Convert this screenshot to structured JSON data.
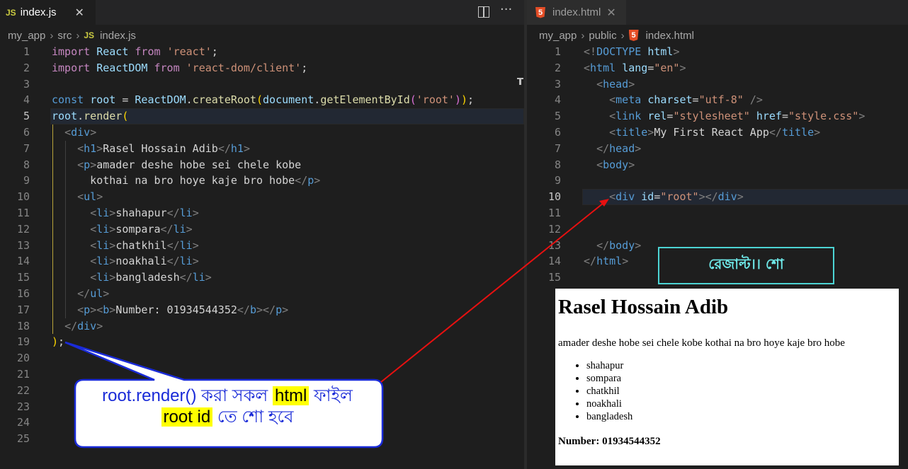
{
  "left_tab": {
    "icon": "JS",
    "label": "index.js",
    "close": "✕"
  },
  "left_breadcrumb": [
    "my_app",
    "src",
    "index.js"
  ],
  "left_active_line": 5,
  "left_lines": [
    [
      [
        "kw",
        "import"
      ],
      [
        "p",
        " "
      ],
      [
        "v",
        "React"
      ],
      [
        "p",
        " "
      ],
      [
        "kw",
        "from"
      ],
      [
        "p",
        " "
      ],
      [
        "s",
        "'react'"
      ],
      [
        "p",
        ";"
      ]
    ],
    [
      [
        "kw",
        "import"
      ],
      [
        "p",
        " "
      ],
      [
        "v",
        "ReactDOM"
      ],
      [
        "p",
        " "
      ],
      [
        "kw",
        "from"
      ],
      [
        "p",
        " "
      ],
      [
        "s",
        "'react-dom/client'"
      ],
      [
        "p",
        ";"
      ]
    ],
    [],
    [
      [
        "k",
        "const"
      ],
      [
        "p",
        " "
      ],
      [
        "v",
        "root"
      ],
      [
        "p",
        " = "
      ],
      [
        "v",
        "ReactDOM"
      ],
      [
        "p",
        "."
      ],
      [
        "f",
        "createRoot"
      ],
      [
        "y",
        "("
      ],
      [
        "v",
        "document"
      ],
      [
        "p",
        "."
      ],
      [
        "f",
        "getElementById"
      ],
      [
        "vio",
        "("
      ],
      [
        "s",
        "'root'"
      ],
      [
        "vio",
        ")"
      ],
      [
        "y",
        ")"
      ],
      [
        "p",
        ";"
      ]
    ],
    [
      [
        "v",
        "root"
      ],
      [
        "p",
        "."
      ],
      [
        "f",
        "render"
      ],
      [
        "y",
        "("
      ]
    ],
    [
      [
        "p",
        "  "
      ],
      [
        "g",
        "<"
      ],
      [
        "t",
        "div"
      ],
      [
        "g",
        ">"
      ]
    ],
    [
      [
        "p",
        "    "
      ],
      [
        "g",
        "<"
      ],
      [
        "t",
        "h1"
      ],
      [
        "g",
        ">"
      ],
      [
        "tx",
        "Rasel Hossain Adib"
      ],
      [
        "g",
        "</"
      ],
      [
        "t",
        "h1"
      ],
      [
        "g",
        ">"
      ]
    ],
    [
      [
        "p",
        "    "
      ],
      [
        "g",
        "<"
      ],
      [
        "t",
        "p"
      ],
      [
        "g",
        ">"
      ],
      [
        "tx",
        "amader deshe hobe sei chele kobe"
      ]
    ],
    [
      [
        "tx",
        "      kothai na bro hoye kaje bro hobe"
      ],
      [
        "g",
        "</"
      ],
      [
        "t",
        "p"
      ],
      [
        "g",
        ">"
      ]
    ],
    [
      [
        "p",
        "    "
      ],
      [
        "g",
        "<"
      ],
      [
        "t",
        "ul"
      ],
      [
        "g",
        ">"
      ]
    ],
    [
      [
        "p",
        "      "
      ],
      [
        "g",
        "<"
      ],
      [
        "t",
        "li"
      ],
      [
        "g",
        ">"
      ],
      [
        "tx",
        "shahapur"
      ],
      [
        "g",
        "</"
      ],
      [
        "t",
        "li"
      ],
      [
        "g",
        ">"
      ]
    ],
    [
      [
        "p",
        "      "
      ],
      [
        "g",
        "<"
      ],
      [
        "t",
        "li"
      ],
      [
        "g",
        ">"
      ],
      [
        "tx",
        "sompara"
      ],
      [
        "g",
        "</"
      ],
      [
        "t",
        "li"
      ],
      [
        "g",
        ">"
      ]
    ],
    [
      [
        "p",
        "      "
      ],
      [
        "g",
        "<"
      ],
      [
        "t",
        "li"
      ],
      [
        "g",
        ">"
      ],
      [
        "tx",
        "chatkhil"
      ],
      [
        "g",
        "</"
      ],
      [
        "t",
        "li"
      ],
      [
        "g",
        ">"
      ]
    ],
    [
      [
        "p",
        "      "
      ],
      [
        "g",
        "<"
      ],
      [
        "t",
        "li"
      ],
      [
        "g",
        ">"
      ],
      [
        "tx",
        "noakhali"
      ],
      [
        "g",
        "</"
      ],
      [
        "t",
        "li"
      ],
      [
        "g",
        ">"
      ]
    ],
    [
      [
        "p",
        "      "
      ],
      [
        "g",
        "<"
      ],
      [
        "t",
        "li"
      ],
      [
        "g",
        ">"
      ],
      [
        "tx",
        "bangladesh"
      ],
      [
        "g",
        "</"
      ],
      [
        "t",
        "li"
      ],
      [
        "g",
        ">"
      ]
    ],
    [
      [
        "p",
        "    "
      ],
      [
        "g",
        "</"
      ],
      [
        "t",
        "ul"
      ],
      [
        "g",
        ">"
      ]
    ],
    [
      [
        "p",
        "    "
      ],
      [
        "g",
        "<"
      ],
      [
        "t",
        "p"
      ],
      [
        "g",
        "><"
      ],
      [
        "t",
        "b"
      ],
      [
        "g",
        ">"
      ],
      [
        "tx",
        "Number: 01934544352"
      ],
      [
        "g",
        "</"
      ],
      [
        "t",
        "b"
      ],
      [
        "g",
        "></"
      ],
      [
        "t",
        "p"
      ],
      [
        "g",
        ">"
      ]
    ],
    [
      [
        "p",
        "  "
      ],
      [
        "g",
        "</"
      ],
      [
        "t",
        "div"
      ],
      [
        "g",
        ">"
      ]
    ],
    [
      [
        "y",
        ")"
      ],
      [
        "p",
        ";"
      ]
    ],
    [],
    [],
    [],
    [],
    [],
    []
  ],
  "right_tab": {
    "icon": "5",
    "label": "index.html",
    "close": "✕"
  },
  "right_breadcrumb": [
    "my_app",
    "public",
    "index.html"
  ],
  "right_active_line": 10,
  "right_lines": [
    [
      [
        "g",
        "<!"
      ],
      [
        "t",
        "DOCTYPE"
      ],
      [
        "p",
        " "
      ],
      [
        "a",
        "html"
      ],
      [
        "g",
        ">"
      ]
    ],
    [
      [
        "g",
        "<"
      ],
      [
        "t",
        "html"
      ],
      [
        "p",
        " "
      ],
      [
        "a",
        "lang"
      ],
      [
        "p",
        "="
      ],
      [
        "s",
        "\"en\""
      ],
      [
        "g",
        ">"
      ]
    ],
    [
      [
        "p",
        "  "
      ],
      [
        "g",
        "<"
      ],
      [
        "t",
        "head"
      ],
      [
        "g",
        ">"
      ]
    ],
    [
      [
        "p",
        "    "
      ],
      [
        "g",
        "<"
      ],
      [
        "t",
        "meta"
      ],
      [
        "p",
        " "
      ],
      [
        "a",
        "charset"
      ],
      [
        "p",
        "="
      ],
      [
        "s",
        "\"utf-8\""
      ],
      [
        "p",
        " "
      ],
      [
        "g",
        "/>"
      ]
    ],
    [
      [
        "p",
        "    "
      ],
      [
        "g",
        "<"
      ],
      [
        "t",
        "link"
      ],
      [
        "p",
        " "
      ],
      [
        "a",
        "rel"
      ],
      [
        "p",
        "="
      ],
      [
        "s",
        "\"stylesheet\""
      ],
      [
        "p",
        " "
      ],
      [
        "a",
        "href"
      ],
      [
        "p",
        "="
      ],
      [
        "s",
        "\"style.css\""
      ],
      [
        "g",
        ">"
      ]
    ],
    [
      [
        "p",
        "    "
      ],
      [
        "g",
        "<"
      ],
      [
        "t",
        "title"
      ],
      [
        "g",
        ">"
      ],
      [
        "tx",
        "My First React App"
      ],
      [
        "g",
        "</"
      ],
      [
        "t",
        "title"
      ],
      [
        "g",
        ">"
      ]
    ],
    [
      [
        "p",
        "  "
      ],
      [
        "g",
        "</"
      ],
      [
        "t",
        "head"
      ],
      [
        "g",
        ">"
      ]
    ],
    [
      [
        "p",
        "  "
      ],
      [
        "g",
        "<"
      ],
      [
        "t",
        "body"
      ],
      [
        "g",
        ">"
      ]
    ],
    [],
    [
      [
        "p",
        "    "
      ],
      [
        "g",
        "<"
      ],
      [
        "t",
        "div"
      ],
      [
        "p",
        " "
      ],
      [
        "a",
        "id"
      ],
      [
        "p",
        "="
      ],
      [
        "s",
        "\"root\""
      ],
      [
        "g",
        "></"
      ],
      [
        "t",
        "div"
      ],
      [
        "g",
        ">"
      ]
    ],
    [],
    [],
    [
      [
        "p",
        "  "
      ],
      [
        "g",
        "</"
      ],
      [
        "t",
        "body"
      ],
      [
        "g",
        ">"
      ]
    ],
    [
      [
        "g",
        "</"
      ],
      [
        "t",
        "html"
      ],
      [
        "g",
        ">"
      ]
    ],
    []
  ],
  "result_label": "রেজাল্ট।। শো",
  "preview": {
    "h1": "Rasel Hossain Adib",
    "para": "amader deshe hobe sei chele kobe kothai na bro hoye kaje bro hobe",
    "items": [
      "shahapur",
      "sompara",
      "chatkhil",
      "noakhali",
      "bangladesh"
    ],
    "number": "Number: 01934544352"
  },
  "callout": {
    "pre": "root.render() করা সকল ",
    "hl1": "html",
    "mid": " ফাইল",
    "hl2": "root id",
    "post": " তে শো হবে"
  },
  "colors": {
    "callout_text": "#1a2bd8",
    "callout_border": "#1a2bd8",
    "arrow": "#e81010",
    "highlight": "#ffff00"
  }
}
